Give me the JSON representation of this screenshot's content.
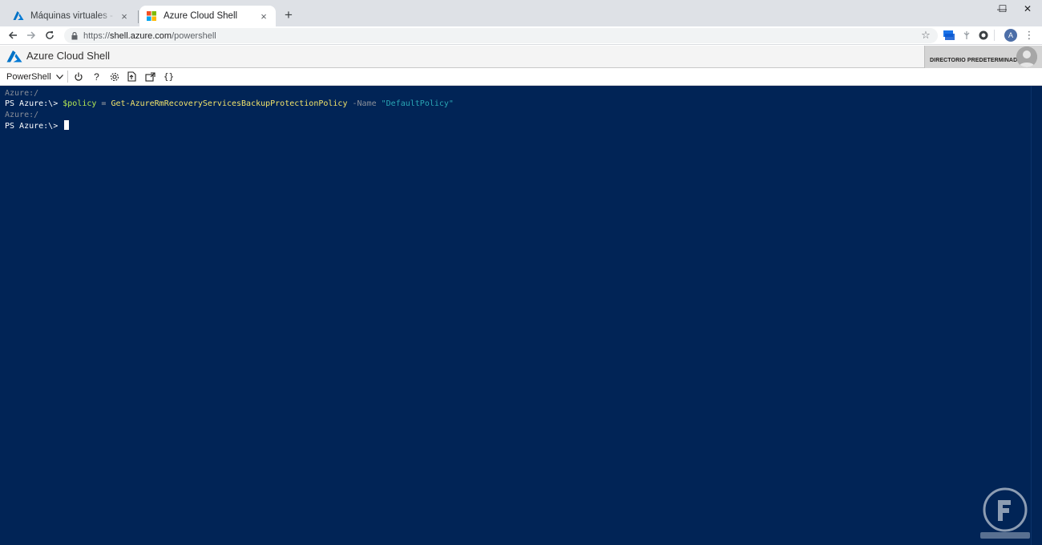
{
  "browser": {
    "tabs": [
      {
        "title": "Máquinas virtuales - Microsoft Azure",
        "active": false,
        "icon": "azure-a-icon"
      },
      {
        "title": "Azure Cloud Shell",
        "active": true,
        "icon": "microsoft-logo-icon"
      }
    ],
    "new_tab_label": "+",
    "window_controls": {
      "minimize": "—",
      "maximize": "☐",
      "close": "✕"
    },
    "address": {
      "scheme": "https://",
      "host": "shell.azure.com",
      "path": "/powershell"
    },
    "profile_initial": "A"
  },
  "shell": {
    "title": "Azure Cloud Shell",
    "directory_label": "DIRECTORIO PREDETERMINADO",
    "environment": "PowerShell",
    "toolbar_icons": [
      "power-icon",
      "help-icon",
      "settings-icon",
      "upload-download-icon",
      "open-new-session-icon",
      "editor-braces-icon"
    ],
    "colors": {
      "terminal_bg": "#012456",
      "variable": "#b5e853",
      "cmdlet": "#f2e36b",
      "string": "#2aa6b5"
    }
  },
  "terminal": {
    "line1": "Azure:/",
    "line2": {
      "prompt": "PS Azure:\\> ",
      "variable": "$policy",
      "operator": " = ",
      "cmdlet": "Get-AzureRmRecoveryServicesBackupProtectionPolicy",
      "param": " -Name ",
      "string": "\"DefaultPolicy\""
    },
    "line3": "Azure:/",
    "line4_prompt": "PS Azure:\\> "
  }
}
